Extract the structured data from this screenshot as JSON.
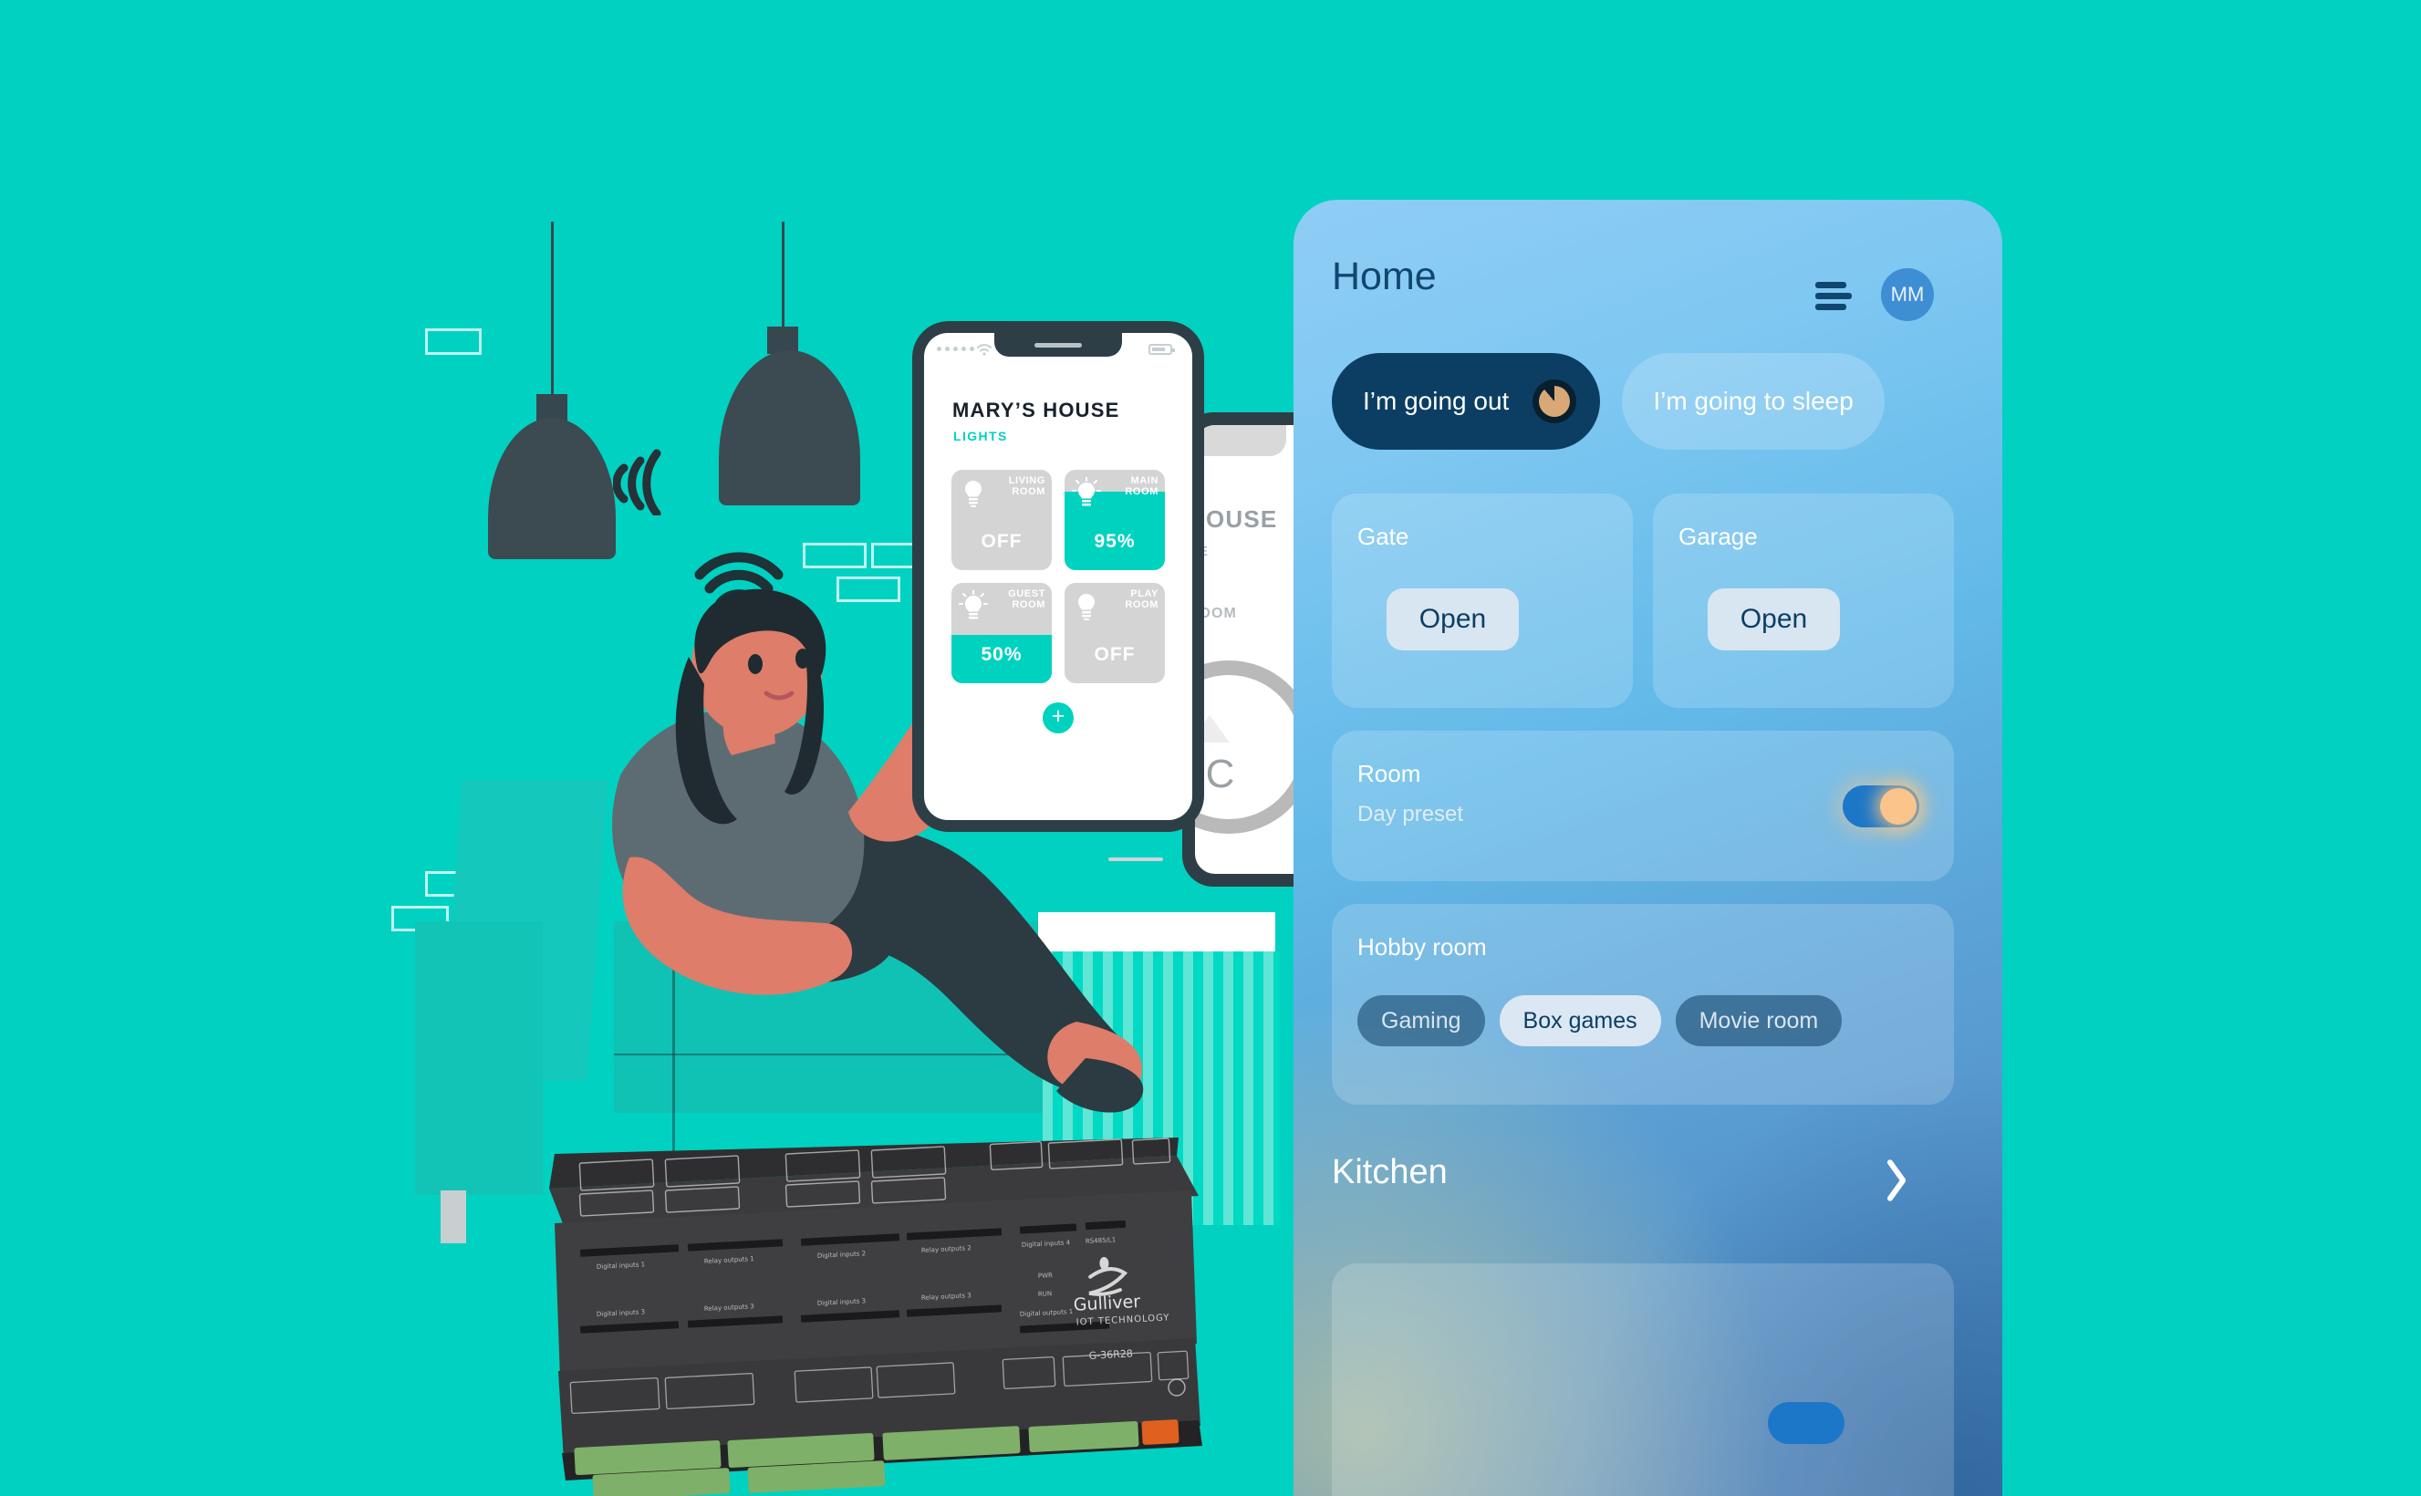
{
  "background_color": "#00d1c1",
  "app": {
    "header": {
      "title": "Home",
      "menu_icon": "hamburger-icon",
      "avatar_initials": "MM"
    },
    "scenes": [
      {
        "label": "I’m going out",
        "state": "active",
        "icon": "clock-icon"
      },
      {
        "label": "I’m going to sleep",
        "state": "inactive"
      }
    ],
    "cards": [
      {
        "name": "Gate",
        "action_label": "Open"
      },
      {
        "name": "Garage",
        "action_label": "Open"
      }
    ],
    "room_card": {
      "title": "Room",
      "subtitle": "Day preset",
      "toggle_state": "on",
      "toggle_color": "#1c77c8",
      "knob_color": "#fac48a"
    },
    "hobby_card": {
      "title": "Hobby room",
      "chips": [
        {
          "label": "Gaming",
          "active": false
        },
        {
          "label": "Box games",
          "active": true
        },
        {
          "label": "Movie room",
          "active": false
        }
      ]
    },
    "kitchen": {
      "title": "Kitchen",
      "chevron_icon": "chevron-right-icon"
    },
    "accent_colors": {
      "panel_title": "#10466f",
      "scene_active_bg": "#0c3e63",
      "pill_bg": "#d8e6f2"
    }
  },
  "illustration": {
    "phone_front": {
      "title": "MARY’S HOUSE",
      "subtitle": "LIGHTS",
      "tiles": [
        {
          "name_line1": "LIVING",
          "name_line2": "ROOM",
          "value": "OFF",
          "fill_percent": 0
        },
        {
          "name_line1": "MAIN",
          "name_line2": "ROOM",
          "value": "95%",
          "fill_percent": 95
        },
        {
          "name_line1": "GUEST",
          "name_line2": "ROOM",
          "value": "50%",
          "fill_percent": 50
        },
        {
          "name_line1": "PLAY",
          "name_line2": "ROOM",
          "value": "OFF",
          "fill_percent": 0
        }
      ],
      "add_button": "+",
      "accent": "#00d2c0"
    },
    "phone_back": {
      "title": "HOUSE",
      "subtitle": "RE",
      "room": "ROOM",
      "temp_unit": "°C"
    },
    "controller": {
      "brand": "Gulliver",
      "tagline": "IOT TECHNOLOGY",
      "model": "G-36R28",
      "labels": [
        "Digital inputs 1",
        "Relay outputs 1",
        "Digital inputs 2",
        "Relay outputs 2",
        "Digital inputs 3",
        "Relay outputs 3",
        "Digital inputs 4",
        "RS485 / L1",
        "Digital outputs 1",
        "PWR",
        "RUN"
      ]
    },
    "icons": [
      "pendant-lamp-icon",
      "pendant-lamp-icon",
      "wifi-signal-icon",
      "wifi-signal-icon"
    ]
  }
}
